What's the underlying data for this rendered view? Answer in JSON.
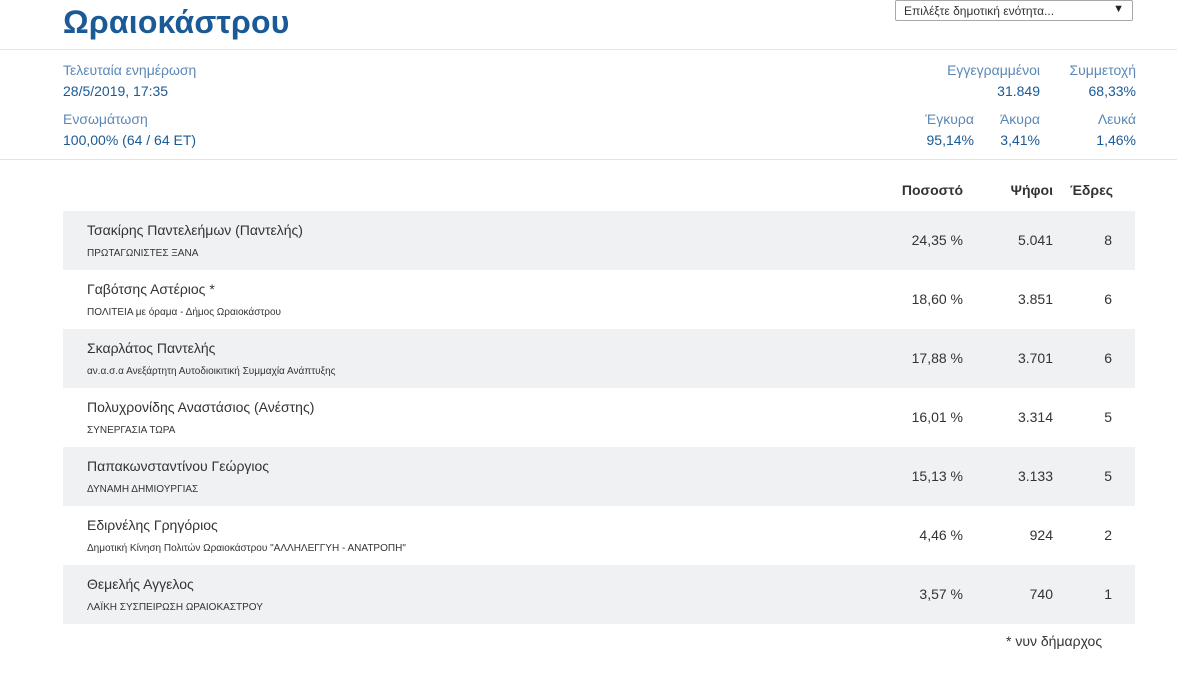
{
  "header": {
    "title": "Ωραιοκάστρου",
    "select": {
      "placeholder": "Επιλέξτε δημοτική ενότητα...",
      "arrow_icon": "triangle-down-icon"
    }
  },
  "summary": {
    "last_update_label": "Τελευταία ενημέρωση",
    "last_update_value": "28/5/2019, 17:35",
    "integration_label": "Ενσωμάτωση",
    "integration_value": "100,00% (64 / 64 ΕΤ)",
    "registered_label": "Εγγεγραμμένοι",
    "registered_value": "31.849",
    "turnout_label": "Συμμετοχή",
    "turnout_value": "68,33%",
    "valid_label": "Έγκυρα",
    "valid_value": "95,14%",
    "invalid_label": "Άκυρα",
    "invalid_value": "3,41%",
    "blank_label": "Λευκά",
    "blank_value": "1,46%"
  },
  "table": {
    "columns": {
      "percent": "Ποσοστό",
      "votes": "Ψήφοι",
      "seats": "Έδρες"
    },
    "rows": [
      {
        "candidate": "Τσακίρης Παντελεήμων (Παντελής)",
        "party": "ΠΡΩΤΑΓΩΝΙΣΤΕΣ ΞΑΝΑ",
        "percent": "24,35 %",
        "votes": "5.041",
        "seats": "8"
      },
      {
        "candidate": "Γαβότσης Αστέριος *",
        "party": "ΠΟΛΙΤΕΙΑ με όραμα - Δήμος Ωραιοκάστρου",
        "percent": "18,60 %",
        "votes": "3.851",
        "seats": "6"
      },
      {
        "candidate": "Σκαρλάτος Παντελής",
        "party": "αν.α.σ.α Ανεξάρτητη Αυτοδιοικιτική Συμμαχία Ανάπτυξης",
        "percent": "17,88 %",
        "votes": "3.701",
        "seats": "6"
      },
      {
        "candidate": "Πολυχρονίδης Αναστάσιος (Ανέστης)",
        "party": "ΣΥΝΕΡΓΑΣΙΑ ΤΩΡΑ",
        "percent": "16,01 %",
        "votes": "3.314",
        "seats": "5"
      },
      {
        "candidate": "Παπακωνσταντίνου Γεώργιος",
        "party": "ΔΥΝΑΜΗ ΔΗΜΙΟΥΡΓΙΑΣ",
        "percent": "15,13 %",
        "votes": "3.133",
        "seats": "5"
      },
      {
        "candidate": "Εδιρνέλης Γρηγόριος",
        "party": "Δημοτική Κίνηση Πολιτών Ωραιοκάστρου \"ΑΛΛΗΛΕΓΓΥΗ - ΑΝΑΤΡΟΠΗ\"",
        "percent": "4,46 %",
        "votes": "924",
        "seats": "2"
      },
      {
        "candidate": "Θεμελής Αγγελος",
        "party": "ΛΑΪΚΗ ΣΥΣΠΕΙΡΩΣΗ ΩΡΑΙΟΚΑΣΤΡΟΥ",
        "percent": "3,57 %",
        "votes": "740",
        "seats": "1"
      }
    ]
  },
  "footnote": "* νυν δήμαρχος"
}
